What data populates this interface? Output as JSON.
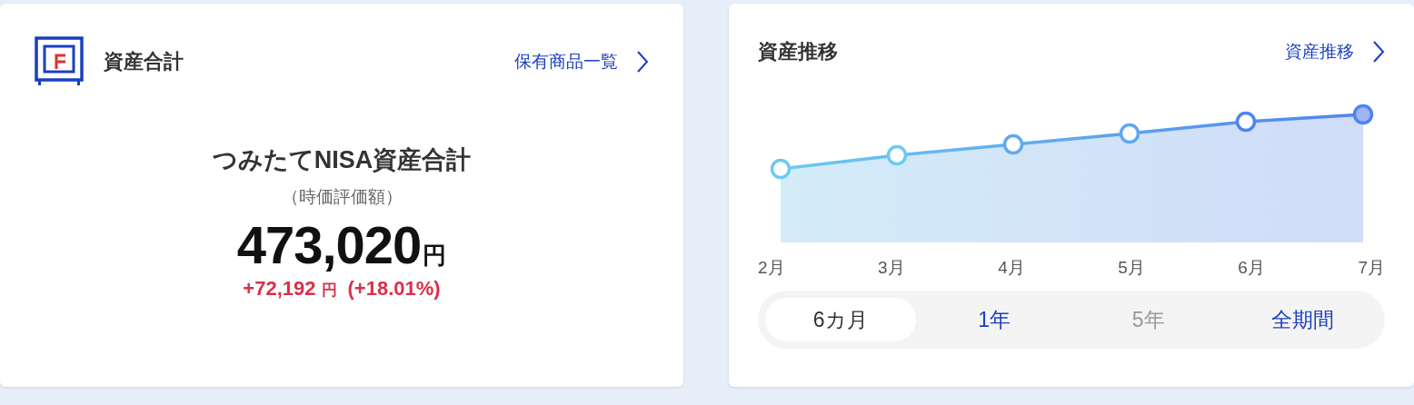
{
  "summary_card": {
    "title": "資産合計",
    "link": "保有商品一覧",
    "heading": "つみたてNISA資産合計",
    "subheading": "（時価評価額）",
    "amount": "473,020",
    "amount_unit": "円",
    "change": "+72,192",
    "change_unit": "円",
    "change_percent": "(+18.01%)"
  },
  "trend_card": {
    "title": "資産推移",
    "link": "資産推移",
    "months": [
      "2月",
      "3月",
      "4月",
      "5月",
      "6月",
      "7月"
    ],
    "periods": [
      {
        "label": "6カ月",
        "selected": true,
        "disabled": false
      },
      {
        "label": "1年",
        "selected": false,
        "disabled": false
      },
      {
        "label": "5年",
        "selected": false,
        "disabled": true
      },
      {
        "label": "全期間",
        "selected": false,
        "disabled": false
      }
    ]
  }
}
